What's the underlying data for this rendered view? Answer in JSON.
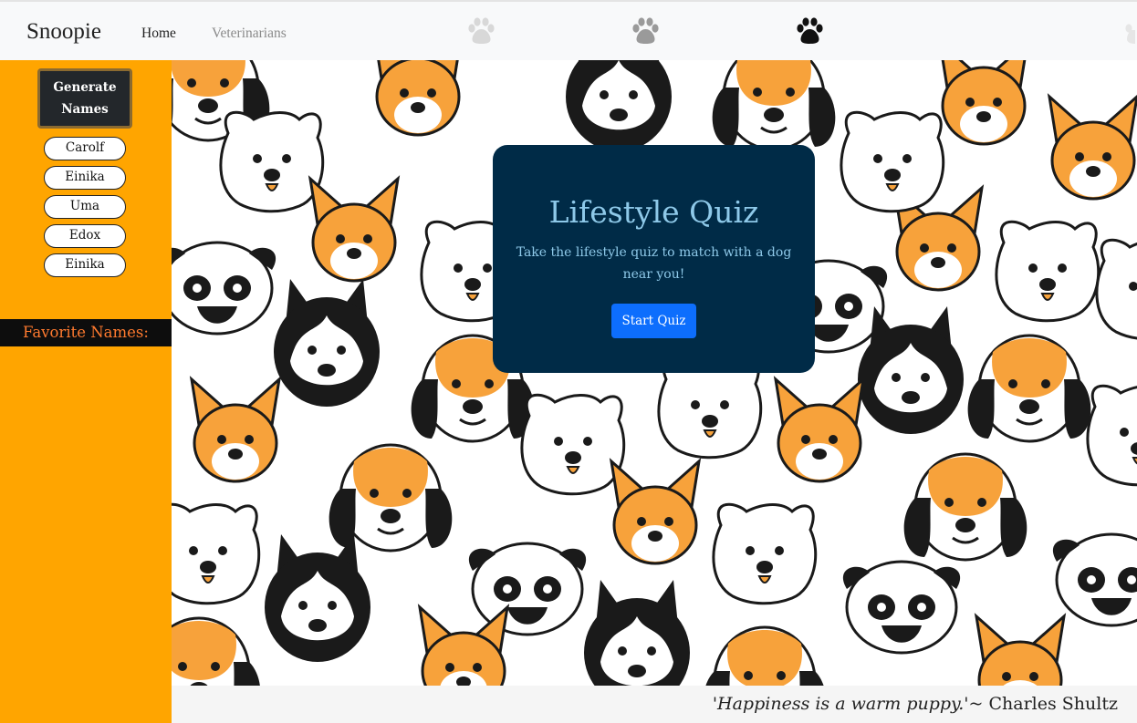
{
  "navbar": {
    "brand": "Snoopie",
    "links": [
      {
        "label": "Home"
      },
      {
        "label": "Veterinarians"
      }
    ],
    "paw_icons": [
      "paw-icon",
      "paw-icon",
      "paw-icon",
      "paw-icon"
    ]
  },
  "sidebar": {
    "generate_button": "Generate Names",
    "names": [
      "Carolf",
      "Einika",
      "Uma",
      "Edox",
      "Einika"
    ],
    "favorites_label": "Favorite Names:"
  },
  "quiz": {
    "title": "Lifestyle Quiz",
    "subtitle": "Take the lifestyle quiz to match with a dog near you!",
    "button": "Start Quiz"
  },
  "footer": {
    "quote": "'Happiness is a warm puppy.'",
    "author": "~ Charles Shultz"
  },
  "colors": {
    "sidebar": "#ffa500",
    "card": "#002b47",
    "card_text": "#8ec9e9",
    "button": "#0d6efd",
    "dog_orange": "#f7a23b"
  }
}
